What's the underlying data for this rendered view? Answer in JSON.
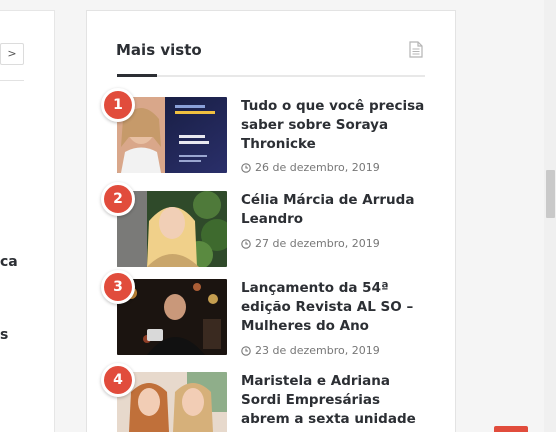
{
  "left": {
    "arrow_glyph": ">",
    "fragments": [
      "ca",
      "s"
    ]
  },
  "widget": {
    "title": "Mais visto",
    "icon": "document-icon"
  },
  "posts": [
    {
      "rank": "1",
      "title": "Tudo o que você precisa saber sobre Soraya Thronicke",
      "date": "26 de dezembro, 2019"
    },
    {
      "rank": "2",
      "title": "Célia Márcia de Arruda Leandro",
      "date": "27 de dezembro, 2019"
    },
    {
      "rank": "3",
      "title": "Lançamento da 54ª edição Revista AL SO – Mulheres do Ano",
      "date": "23 de dezembro, 2019"
    },
    {
      "rank": "4",
      "title": "Maristela e Adriana Sordi Empresárias abrem a sexta unidade do Morena",
      "date": ""
    }
  ],
  "colors": {
    "badge": "#e14c3c",
    "title_text": "#2c2f34",
    "date_text": "#777777"
  }
}
